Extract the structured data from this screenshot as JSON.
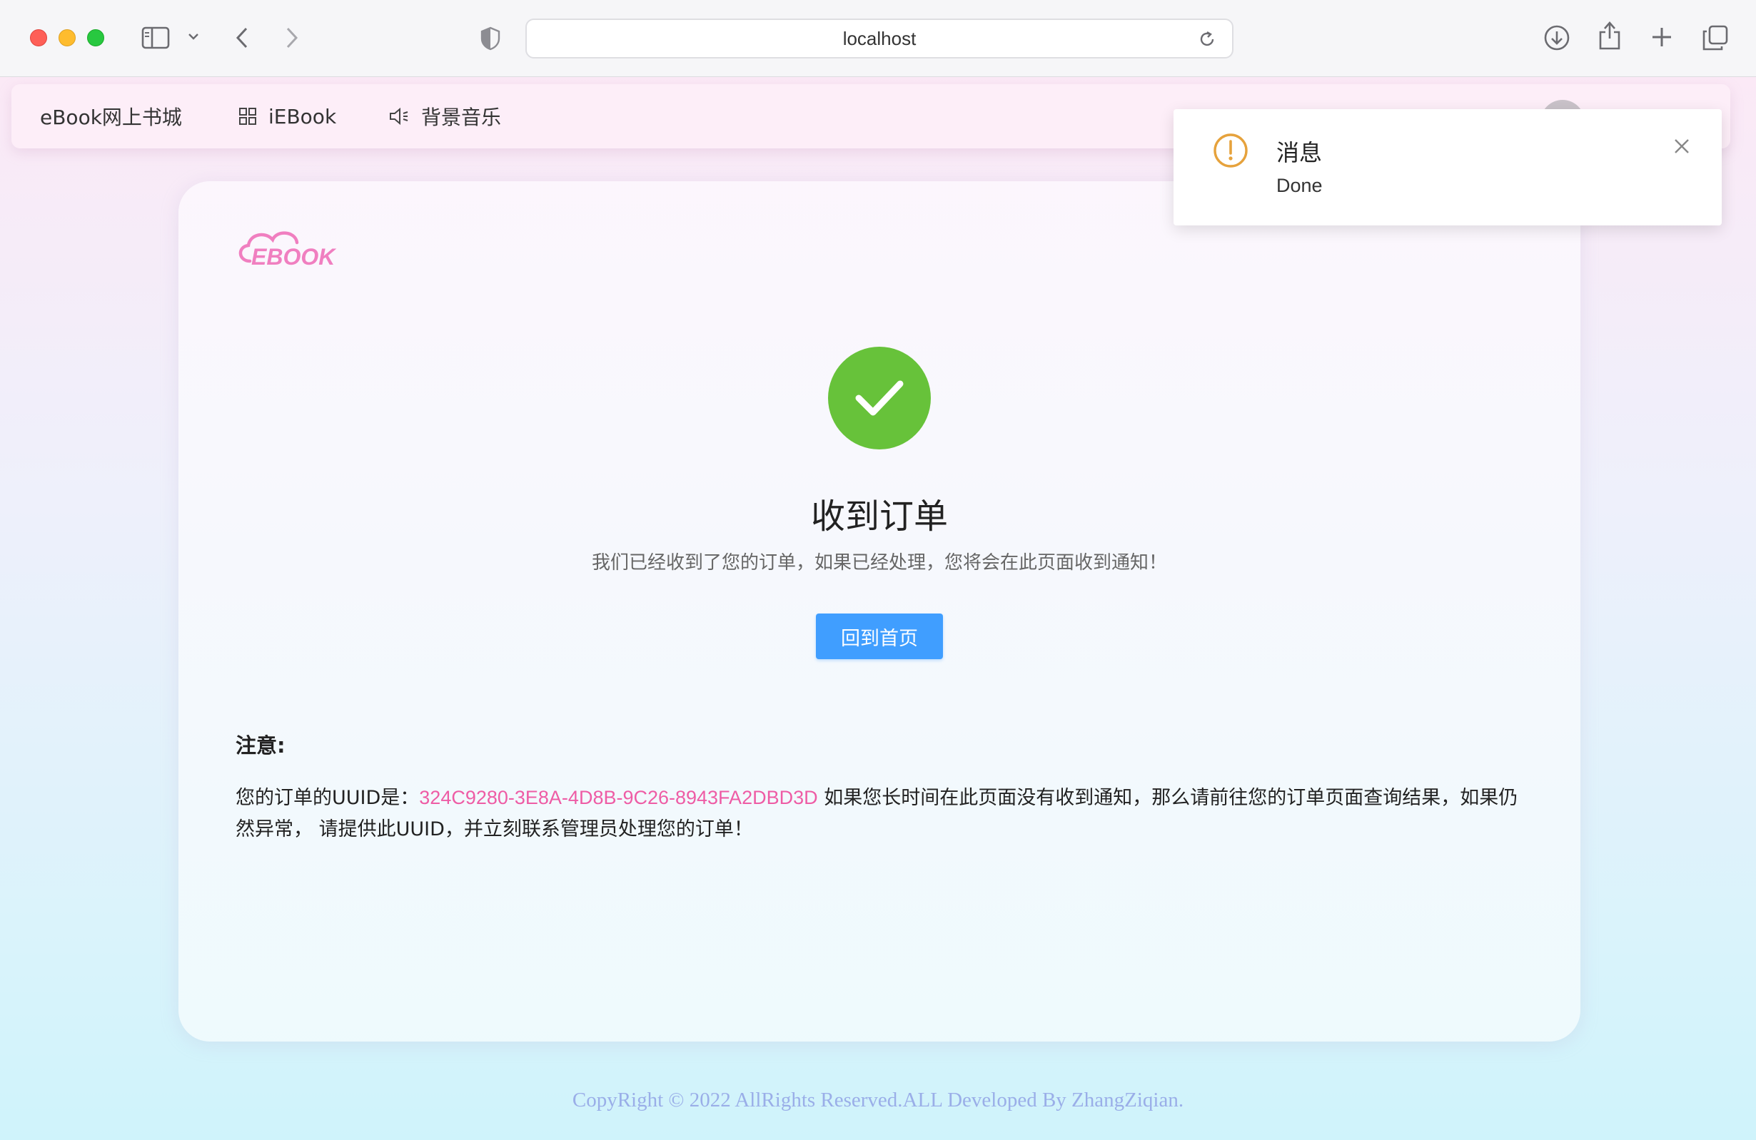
{
  "browser": {
    "url": "localhost"
  },
  "navbar": {
    "brand": "eBook网上书城",
    "items": [
      {
        "label": "iEBook",
        "icon": "grid-icon"
      },
      {
        "label": "背景音乐",
        "icon": "speaker-icon"
      }
    ]
  },
  "logo": {
    "text": "EBOOK"
  },
  "result": {
    "title": "收到订单",
    "subtitle": "我们已经收到了您的订单，如果已经处理，您将会在此页面收到通知！",
    "button_label": "回到首页"
  },
  "notice": {
    "title": "注意:",
    "prefix": "您的订单的UUID是：",
    "uuid": "324C9280-3E8A-4D8B-9C26-8943FA2DBD3D",
    "suffix": " 如果您长时间在此页面没有收到通知，那么请前往您的订单页面查询结果，如果仍然异常， 请提供此UUID，并立刻联系管理员处理您的订单！"
  },
  "footer": {
    "text": "CopyRight © 2022 AllRights Reserved.ALL Developed By ZhangZiqian."
  },
  "notification": {
    "title": "消息",
    "message": "Done",
    "icon": "warning-icon"
  },
  "colors": {
    "accent": "#409eff",
    "success": "#67c23a",
    "uuid": "#ee5ca5",
    "warning": "#e6a23c",
    "logo": "#f07fc0",
    "footer": "#9aaee8"
  }
}
